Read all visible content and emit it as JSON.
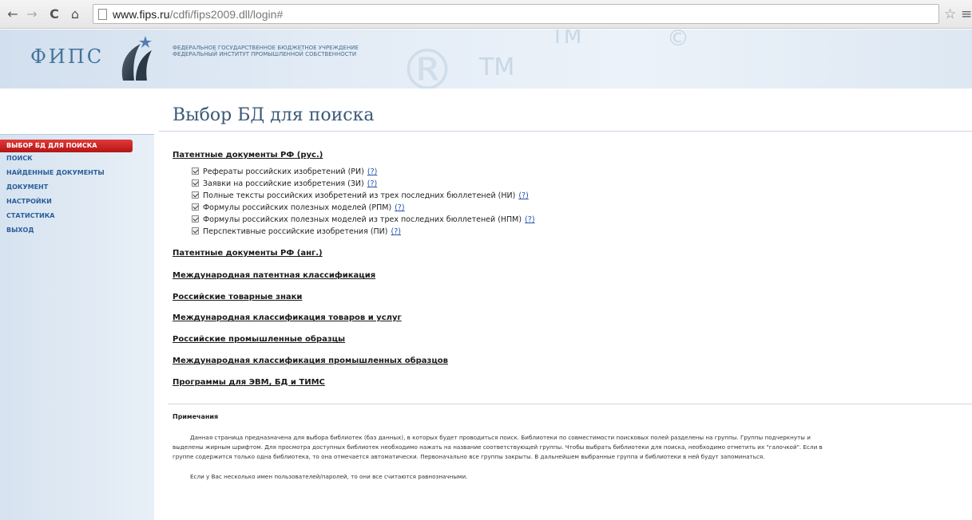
{
  "browser": {
    "url_host": "www.fips.ru",
    "url_path": "/cdfi/fips2009.dll/login#",
    "back_icon": "←",
    "forward_icon": "→",
    "reload_icon": "C",
    "home_icon": "⌂",
    "star_icon": "☆",
    "menu_icon": "≡"
  },
  "header": {
    "logo_text": "ФИПС",
    "org_line1": "ФЕДЕРАЛЬНОЕ ГОСУДАРСТВЕННОЕ БЮДЖЕТНОЕ УЧРЕЖДЕНИЕ",
    "org_line2": "ФЕДЕРАЛЬНЫЙ ИНСТИТУТ ПРОМЫШЛЕННОЙ СОБСТВЕННОСТИ",
    "watermark_r": "®",
    "watermark_tm": "TM",
    "watermark_c": "©"
  },
  "sidebar": {
    "items": [
      {
        "label": "ВЫБОР БД ДЛЯ ПОИСКА",
        "active": true
      },
      {
        "label": "ПОИСК"
      },
      {
        "label": "НАЙДЕННЫЕ ДОКУМЕНТЫ"
      },
      {
        "label": "ДОКУМЕНТ"
      },
      {
        "label": "НАСТРОЙКИ"
      },
      {
        "label": "СТАТИСТИКА"
      },
      {
        "label": "ВЫХОД"
      }
    ]
  },
  "main": {
    "title": "Выбор БД для поиска",
    "help_mark": "?",
    "groups": [
      {
        "label": "Патентные документы РФ (рус.)"
      },
      {
        "label": "Патентные документы РФ (анг.)"
      },
      {
        "label": "Международная патентная классификация"
      },
      {
        "label": "Российские товарные знаки"
      },
      {
        "label": "Международная классификация товаров и услуг"
      },
      {
        "label": "Российские промышленные образцы"
      },
      {
        "label": "Международная классификация промышленных образцов"
      },
      {
        "label": "Программы для ЭВМ, БД и ТИМС"
      }
    ],
    "databases": [
      {
        "label": "Рефераты российских изобретений (РИ)",
        "checked": true
      },
      {
        "label": "Заявки на российские изобретения (ЗИ)",
        "checked": true
      },
      {
        "label": "Полные тексты российских изобретений из трех последних бюллетеней (НИ)",
        "checked": true
      },
      {
        "label": "Формулы российских полезных моделей (РПМ)",
        "checked": true
      },
      {
        "label": "Формулы российских полезных моделей из трех последних бюллетеней (НПМ)",
        "checked": true
      },
      {
        "label": "Перспективные российские изобретения (ПИ)",
        "checked": true
      }
    ]
  },
  "notes": {
    "title": "Примечания",
    "p1_line1": "Данная страница предназначена для выбора библиотек (баз данных), в которых будет проводиться поиск. Библиотеки по совместимости поисковых полей разделены на группы. Группы подчеркнуты и",
    "p1_line2": "выделены жирным шрифтом. Для просмотра доступных библиотек необходимо нажать на название соответствующей группы. Чтобы выбрать библиотеки для поиска, необходимо отметить их \"галочкой\". Если в",
    "p1_line3": "группе содержится только одна библиотека, то она отмечается автоматически. Первоначально все группы закрыты. В дальнейшем выбранные группа и библиотеки в ней будут запоминаться.",
    "p2": "Если у Вас несколько имен пользователей/паролей, то они все считаются равнозначными."
  }
}
